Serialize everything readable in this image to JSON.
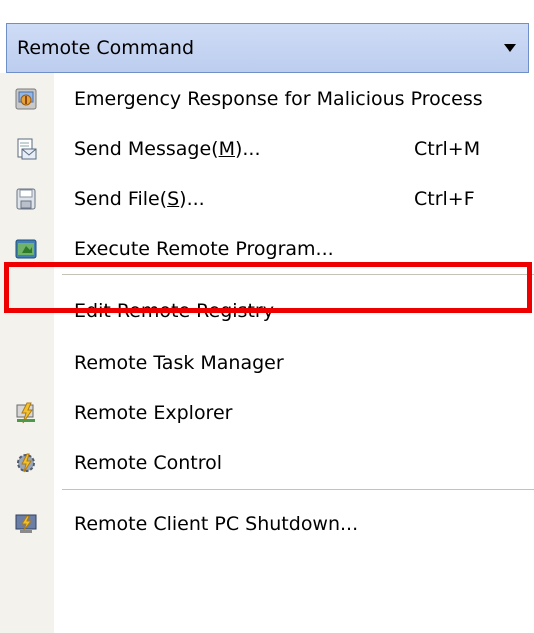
{
  "header": {
    "title": "Remote Command"
  },
  "menu": {
    "items": [
      {
        "label": "Emergency Response for Malicious Process",
        "icon": "shield-process-icon"
      },
      {
        "label_pre": "Send Message(",
        "mnemonic": "M",
        "label_post": ")...",
        "shortcut": "Ctrl+M",
        "icon": "send-message-icon"
      },
      {
        "label_pre": "Send File(",
        "mnemonic": "S",
        "label_post": ")...",
        "shortcut": "Ctrl+F",
        "icon": "send-file-icon"
      },
      {
        "label": "Execute Remote Program...",
        "icon": "execute-program-icon"
      },
      {
        "label": "Edit Remote Registry",
        "highlighted": true
      },
      {
        "label": "Remote Task Manager"
      },
      {
        "label": "Remote Explorer",
        "icon": "remote-explorer-icon"
      },
      {
        "label": "Remote Control",
        "icon": "remote-control-icon"
      },
      {
        "label": "Remote Client PC Shutdown...",
        "icon": "shutdown-icon"
      }
    ]
  },
  "colors": {
    "header_bg": "#c4d3f1",
    "header_border": "#6f8fc9",
    "icon_strip": "#f3f2ec",
    "highlight_border": "#ee0000"
  }
}
